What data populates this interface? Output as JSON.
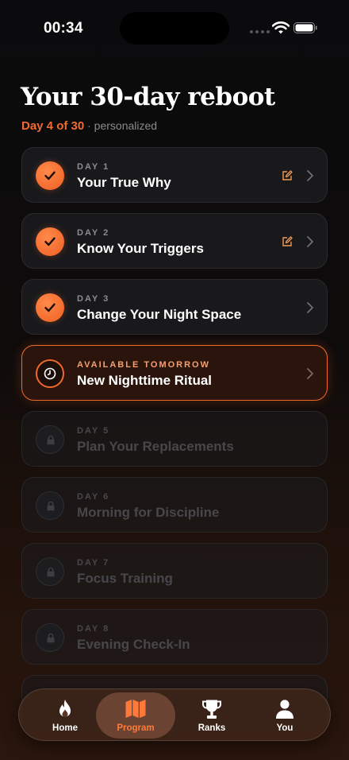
{
  "status": {
    "time": "00:34"
  },
  "header": {
    "title": "Your 30-day reboot",
    "progress": "Day 4 of 30",
    "separator": "·",
    "tag": "personalized"
  },
  "days": [
    {
      "label": "DAY 1",
      "title": "Your True Why",
      "state": "completed",
      "has_note": true
    },
    {
      "label": "DAY 2",
      "title": "Know Your Triggers",
      "state": "completed",
      "has_note": true
    },
    {
      "label": "DAY 3",
      "title": "Change Your Night Space",
      "state": "completed",
      "has_note": false
    },
    {
      "label": "AVAILABLE TOMORROW",
      "title": "New Nighttime Ritual",
      "state": "upcoming",
      "has_note": false
    },
    {
      "label": "DAY 5",
      "title": "Plan Your Replacements",
      "state": "locked",
      "has_note": false
    },
    {
      "label": "DAY 6",
      "title": "Morning for Discipline",
      "state": "locked",
      "has_note": false
    },
    {
      "label": "DAY 7",
      "title": "Focus Training",
      "state": "locked",
      "has_note": false
    },
    {
      "label": "DAY 8",
      "title": "Evening Check-In",
      "state": "locked",
      "has_note": false
    }
  ],
  "tabs": [
    {
      "label": "Home",
      "icon": "flame-icon",
      "selected": false
    },
    {
      "label": "Program",
      "icon": "map-icon",
      "selected": true
    },
    {
      "label": "Ranks",
      "icon": "trophy-icon",
      "selected": false
    },
    {
      "label": "You",
      "icon": "person-icon",
      "selected": false
    }
  ],
  "colors": {
    "accent": "#f0692c",
    "background": "#0b0b0d",
    "card": "#19191c"
  }
}
